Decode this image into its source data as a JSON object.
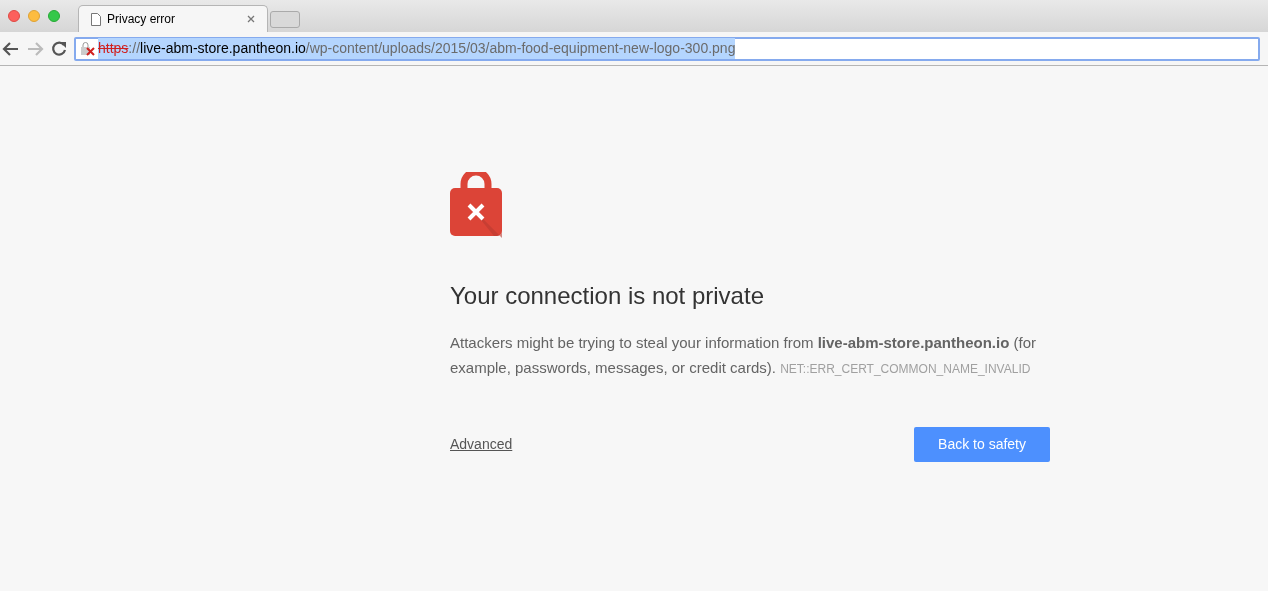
{
  "tabs": [
    {
      "title": "Privacy error",
      "selected": true
    }
  ],
  "address_bar": {
    "selected": true,
    "segments": [
      {
        "kind": "scheme",
        "text": "https"
      },
      {
        "kind": "path",
        "text": "://"
      },
      {
        "kind": "host",
        "text": "live-abm-store.pantheon.io"
      },
      {
        "kind": "path",
        "text": "/wp-content/uploads/2015/03/abm-food-equipment-new-logo-300.png"
      }
    ]
  },
  "page": {
    "heading": "Your connection is not private",
    "message": "Attackers might be trying to steal your information from **live-abm-store.pantheon.io** (for example, passwords, messages, or credit cards).",
    "error_code": "NET::ERR_CERT_COMMON_NAME_INVALID",
    "advanced_link": "Advanced",
    "primary_button": "Back to safety"
  }
}
